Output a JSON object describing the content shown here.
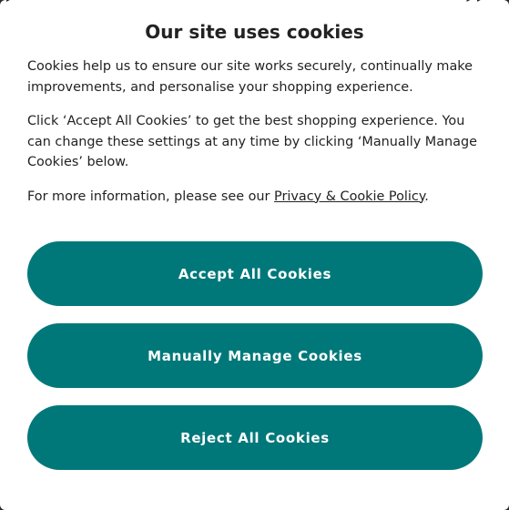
{
  "dialog": {
    "title": "Our site uses cookies",
    "paragraph_1": "Cookies help us to ensure our site works securely, continually make improvements, and personalise your shopping experience.",
    "paragraph_2": "Click ‘Accept All Cookies’ to get the best shopping experience. You can change these settings at any time by clicking ‘Manually Manage Cookies’ below.",
    "paragraph_3_prefix": "For more information, please see our ",
    "policy_link": "Privacy & Cookie Policy",
    "paragraph_3_suffix": ".",
    "buttons": {
      "accept": "Accept All Cookies",
      "manual": "Manually Manage Cookies",
      "reject": "Reject All Cookies"
    }
  },
  "colors": {
    "button_bg": "#00787a",
    "button_text": "#ffffff",
    "text": "#222222",
    "dialog_bg": "#ffffff"
  }
}
